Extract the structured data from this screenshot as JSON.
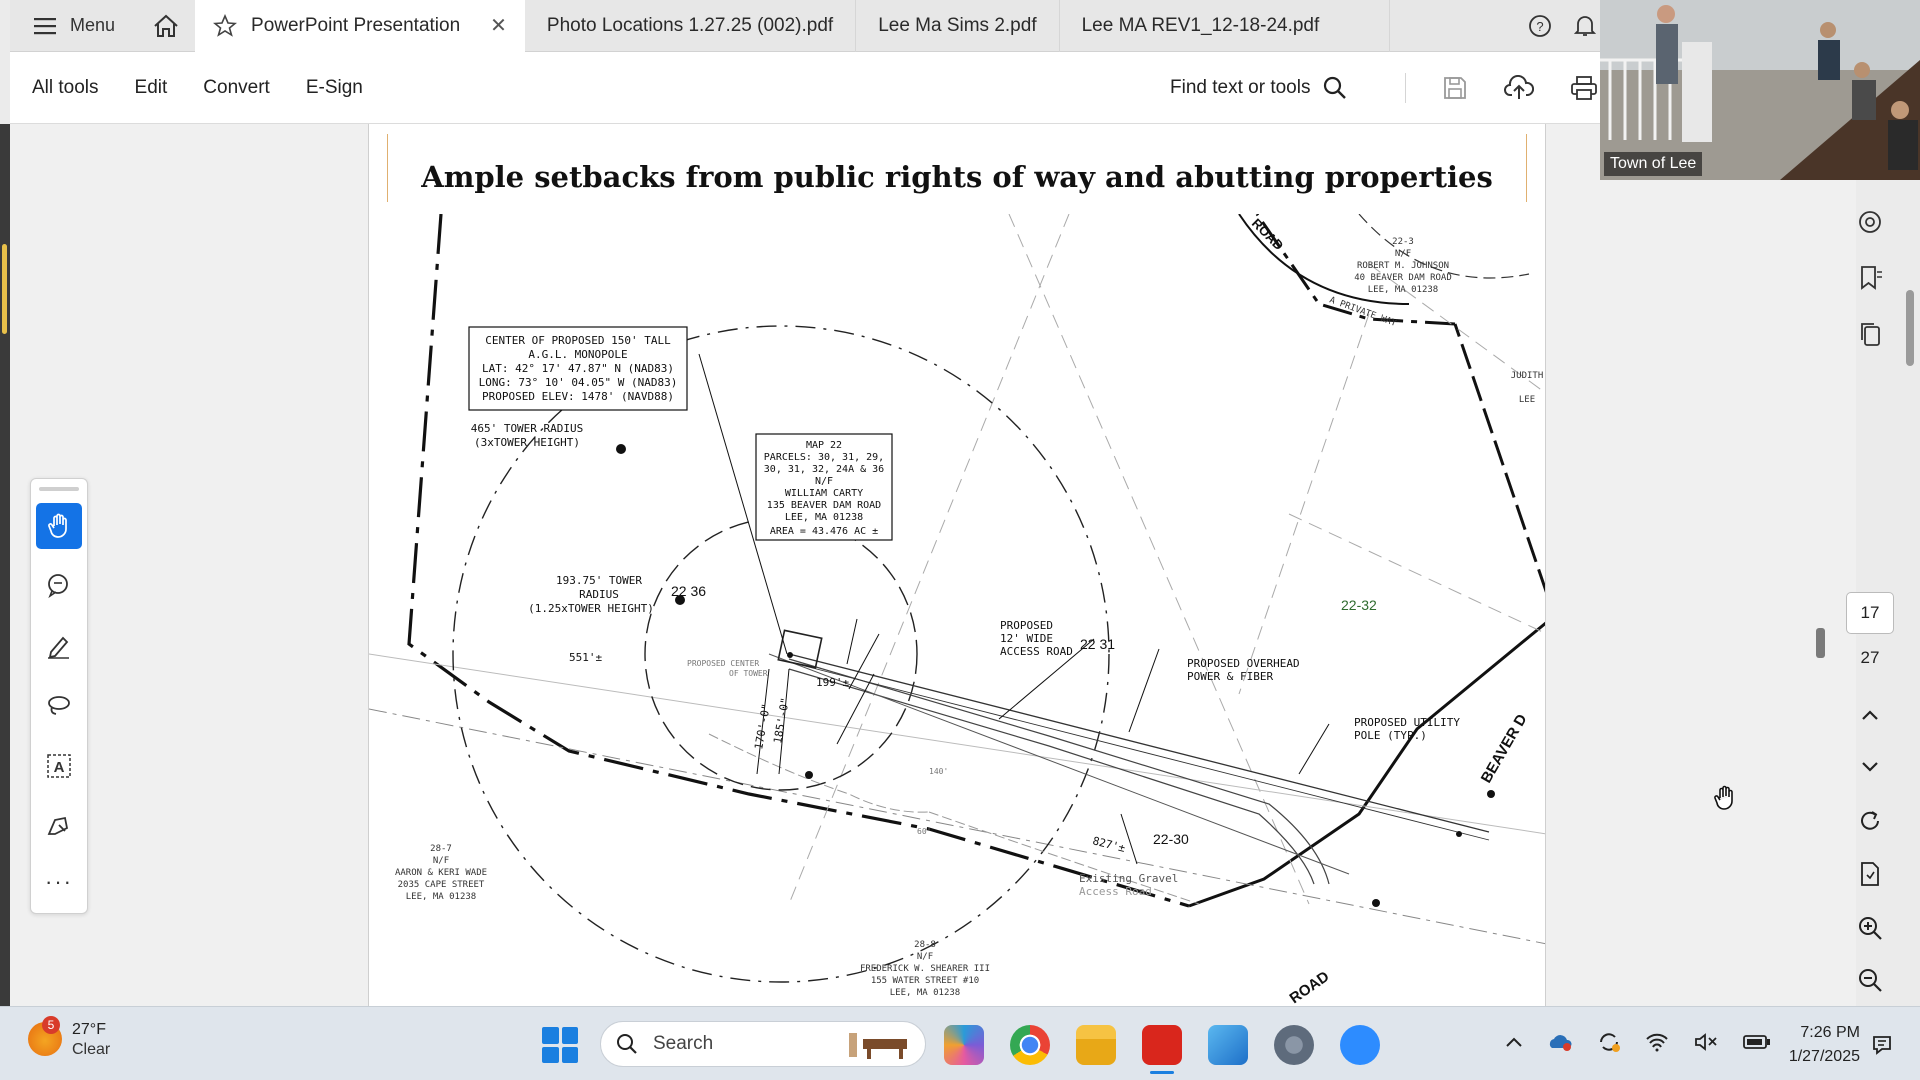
{
  "tabbar": {
    "menu_label": "Menu",
    "tabs": [
      {
        "label": "PowerPoint Presentation",
        "active": true
      },
      {
        "label": "Photo Locations 1.27.25 (002).pdf"
      },
      {
        "label": "Lee Ma Sims 2.pdf"
      },
      {
        "label": "Lee MA REV1_12-18-24.pdf"
      }
    ]
  },
  "toolbar": {
    "all_tools": "All tools",
    "edit": "Edit",
    "convert": "Convert",
    "esign": "E-Sign",
    "find": "Find text or tools"
  },
  "document": {
    "title": "Ample setbacks from public rights of way and abutting properties",
    "labels": {
      "center_box": [
        "CENTER OF PROPOSED 150' TALL",
        "A.G.L. MONOPOLE",
        "LAT: 42° 17' 47.87\" N (NAD83)",
        "LONG: 73° 10' 04.05\" W (NAD83)",
        "PROPOSED ELEV: 1478' (NAVD88)"
      ],
      "tower_465": [
        "465' TOWER RADIUS",
        "(3xTOWER HEIGHT)"
      ],
      "tower_193": [
        "193.75' TOWER",
        "RADIUS",
        "(1.25xTOWER HEIGHT)"
      ],
      "parcel_box": [
        "MAP 22",
        "PARCELS: 30, 31, 29,",
        "30, 31, 32, 24A & 36",
        "N/F",
        "WILLIAM CARTY",
        "135 BEAVER DAM ROAD",
        "LEE, MA 01238",
        "AREA = 43.476 AC ±"
      ],
      "lot_2236": "22 36",
      "lot_2231": "22 31",
      "lot_2232": "22-32",
      "lot_2230": "22-30",
      "access_road": [
        "PROPOSED",
        "12' WIDE",
        "ACCESS ROAD"
      ],
      "overhead": [
        "PROPOSED OVERHEAD",
        "POWER & FIBER"
      ],
      "utility_pole": [
        "PROPOSED UTILITY",
        "POLE (TYP.)"
      ],
      "dist_551": "551'±",
      "dist_827": "827'±",
      "dist_199": "199'±",
      "dist_170": "170'-0\"",
      "dist_185": "185'-0\"",
      "road_top": "ROAD",
      "private_way": "A PRIVATE WAY",
      "beaver": "BEAVER D",
      "road_bottom": "ROAD",
      "johnson": [
        "22-3",
        "N/F",
        "ROBERT M. JOHNSON",
        "40 BEAVER DAM ROAD",
        "LEE, MA 01238"
      ],
      "judith": [
        "JUDITH",
        "LEE"
      ],
      "wade": [
        "28-7",
        "N/F",
        "AARON & KERI WADE",
        "2035 CAPE STREET",
        "LEE, MA 01238"
      ],
      "shearer": [
        "FREDERICK W. SHEARER III",
        "155 WATER STREET #10",
        "LEE, MA 01238"
      ],
      "shearer_top": [
        "28-8",
        "N/F"
      ],
      "existing_gravel": [
        "Existing Gravel",
        "Access Road"
      ],
      "proposed_center": [
        "PROPOSED CENTER",
        "OF TOWER"
      ],
      "angle_140": "140'",
      "angle_60": "60'"
    }
  },
  "pagination": {
    "current": "17",
    "total": "27"
  },
  "video": {
    "label": "Town of Lee"
  },
  "taskbar": {
    "weather_temp": "27°F",
    "weather_cond": "Clear",
    "weather_badge": "5",
    "search_label": "Search",
    "time": "7:26 PM",
    "date": "1/27/2025"
  }
}
